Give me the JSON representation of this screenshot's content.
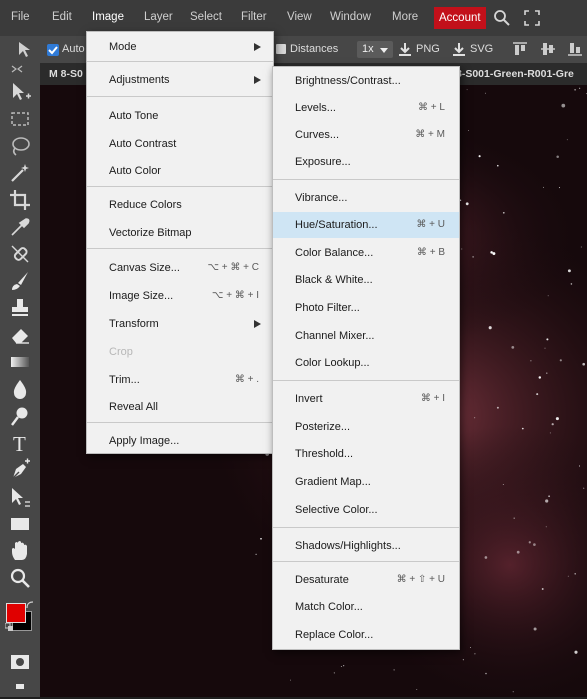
{
  "menubar": {
    "items": [
      "File",
      "Edit",
      "Image",
      "Layer",
      "Select",
      "Filter",
      "View",
      "Window",
      "More"
    ],
    "account_label": "Account"
  },
  "options": {
    "auto_label": "Auto",
    "distances_label": "Distances",
    "zoom_label": "1x",
    "png_label": "PNG",
    "svg_label": "SVG"
  },
  "document": {
    "tab_left": "M 8-S0",
    "tab_right": "8-S001-Green-R001-Gre"
  },
  "image_menu": {
    "items": [
      "Mode",
      "Adjustments",
      "Auto Tone",
      "Auto Contrast",
      "Auto Color",
      "Reduce Colors",
      "Vectorize Bitmap",
      "Canvas Size...",
      "Image Size...",
      "Transform",
      "Crop",
      "Trim...",
      "Reveal All",
      "Apply Image..."
    ],
    "shortcuts": {
      "canvas": "⌥ + ⌘ + C",
      "image": "⌥ + ⌘ + I",
      "trim": "⌘ + ."
    }
  },
  "adjustments_menu": {
    "items": [
      "Brightness/Contrast...",
      "Levels...",
      "Curves...",
      "Exposure...",
      "Vibrance...",
      "Hue/Saturation...",
      "Color Balance...",
      "Black & White...",
      "Photo Filter...",
      "Channel Mixer...",
      "Color Lookup...",
      "Invert",
      "Posterize...",
      "Threshold...",
      "Gradient Map...",
      "Selective Color...",
      "Shadows/Highlights...",
      "Desaturate",
      "Match Color...",
      "Replace Color..."
    ],
    "shortcuts": {
      "levels": "⌘ + L",
      "curves": "⌘ + M",
      "hue": "⌘ + U",
      "balance": "⌘ + B",
      "invert": "⌘ + I",
      "desaturate": "⌘ + ⇧ + U"
    }
  },
  "colors": {
    "foreground": "#e00000",
    "background": "#000000",
    "accent": "#c2101a",
    "highlight": "#cfe5f4"
  }
}
